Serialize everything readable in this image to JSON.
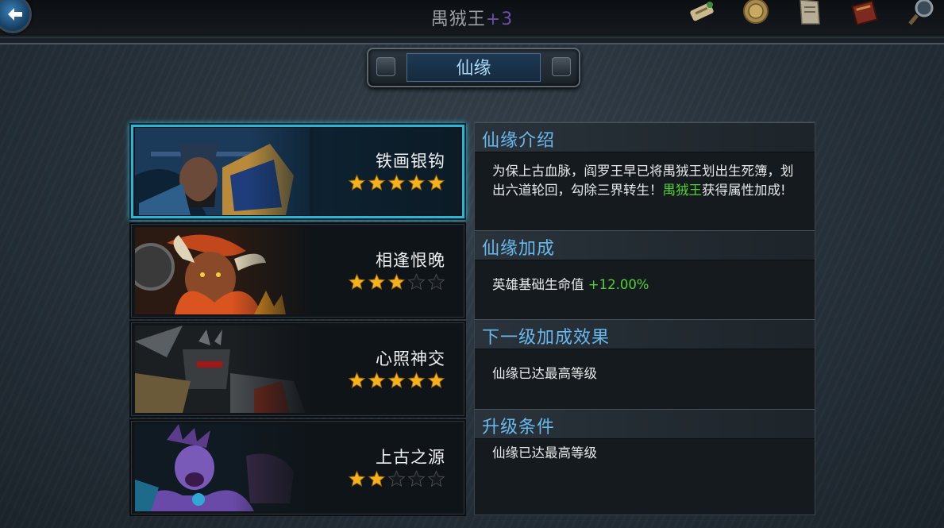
{
  "topbar": {
    "hero_name": "禺狨王",
    "hero_level": "+3",
    "icons": [
      "scroll-icon",
      "coin-badge-icon",
      "notice-paper-icon",
      "book-icon",
      "magnifier-icon"
    ]
  },
  "section_title": "仙缘",
  "fates": [
    {
      "name": "铁画银钩",
      "stars": 5,
      "max_stars": 5,
      "selected": true
    },
    {
      "name": "相逢恨晚",
      "stars": 3,
      "max_stars": 5,
      "selected": false
    },
    {
      "name": "心照神交",
      "stars": 5,
      "max_stars": 5,
      "selected": false
    },
    {
      "name": "上古之源",
      "stars": 2,
      "max_stars": 5,
      "selected": false
    }
  ],
  "info": {
    "intro_header": "仙缘介绍",
    "intro_text_a": "为保上古血脉，阎罗王早已将禺狨王划出生死簿，划出六道轮回，勾除三界转生！",
    "intro_text_hero": "禺狨王",
    "intro_text_b": "获得属性加成!",
    "bonus_header": "仙缘加成",
    "bonus_label": "英雄基础生命值",
    "bonus_value": "+12.00%",
    "next_header": "下一级加成效果",
    "next_text": "仙缘已达最高等级",
    "upgrade_header": "升级条件",
    "upgrade_text": "仙缘已达最高等级"
  },
  "colors": {
    "accent_blue": "#69b9ee",
    "bonus_green": "#52d133",
    "star_gold": "#f5b21c"
  }
}
